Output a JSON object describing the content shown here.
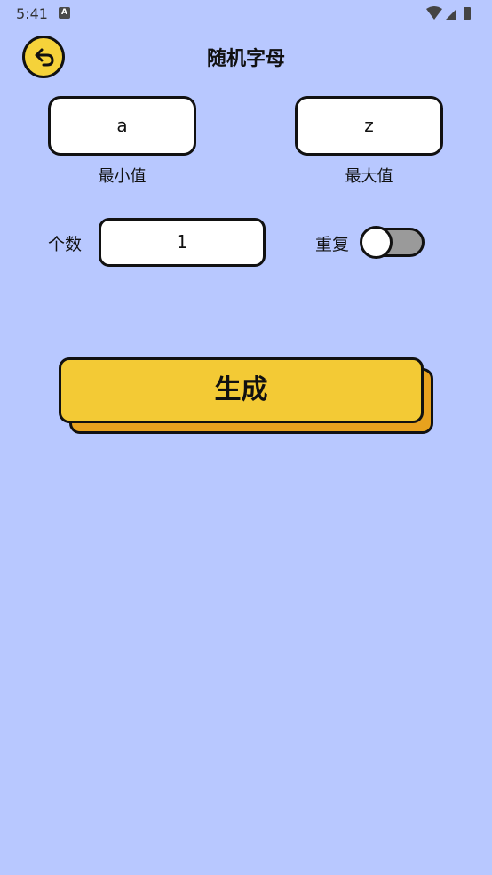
{
  "status_bar": {
    "time": "5:41",
    "notification_icon": "a-letter-icon",
    "icons": [
      "wifi-icon",
      "signal-icon",
      "battery-icon"
    ]
  },
  "header": {
    "back_icon": "back-arrow-icon",
    "title": "随机字母"
  },
  "range": {
    "min_value": "a",
    "min_label": "最小值",
    "max_value": "z",
    "max_label": "最大值"
  },
  "count": {
    "label": "个数",
    "value": "1"
  },
  "repeat": {
    "label": "重复",
    "enabled": false
  },
  "generate": {
    "label": "生成"
  },
  "colors": {
    "background": "#b8c8ff",
    "accent_yellow": "#f3ca35",
    "button_shadow": "#e8a21e",
    "toggle_off": "#9a9a9a"
  }
}
